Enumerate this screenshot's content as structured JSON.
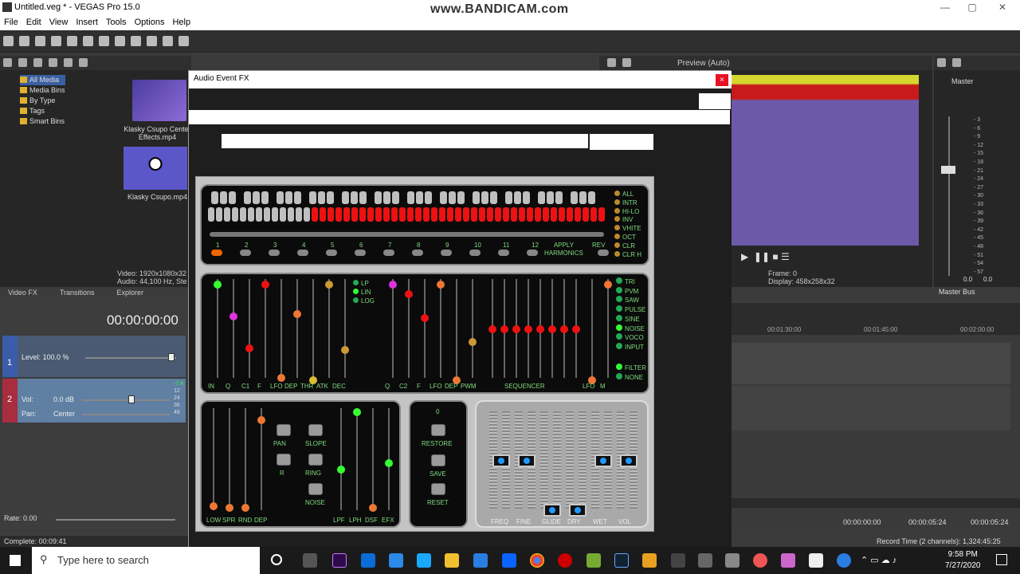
{
  "app": {
    "title": "Untitled.veg * - VEGAS Pro 15.0",
    "watermark": "www.BANDICAM.com"
  },
  "menu": [
    "File",
    "Edit",
    "View",
    "Insert",
    "Tools",
    "Options",
    "Help"
  ],
  "explorer": {
    "tree": [
      "All Media",
      "Media Bins",
      "By Type",
      "Tags",
      "Smart Bins"
    ],
    "media": [
      {
        "name": "Klasky Csupo Center Effects.mp4"
      },
      {
        "name": "Klasky Csupo.mp4"
      }
    ],
    "info": [
      "Video: 1920x1080x32",
      "Audio: 44,100 Hz, Ste"
    ],
    "tabs": [
      "Video FX",
      "Transitions",
      "Explorer"
    ]
  },
  "timecode": "00:00:00:00",
  "tracks": [
    {
      "num": "1",
      "level_label": "Level: 100.0 %"
    },
    {
      "num": "2",
      "vol_label": "Vol:",
      "vol_value": "0.0 dB",
      "pan_label": "Pan:",
      "pan_value": "Center",
      "meter": [
        "-7.4",
        "12",
        "24",
        "36",
        "48"
      ]
    }
  ],
  "rate": "Rate: 0.00",
  "status": "Complete: 00:09:41",
  "dialog": {
    "title": "Audio Event FX",
    "close": "×",
    "keyboard_numbers": [
      "1",
      "2",
      "3",
      "4",
      "5",
      "6",
      "7",
      "8",
      "9",
      "10",
      "11",
      "12"
    ],
    "apply_label": "APPLY\nHARMONICS",
    "rev_label": "REV",
    "wave_opts": [
      "ALL",
      "INTR",
      "HI-LO",
      "INV",
      "VHITE",
      "OCT",
      "CLR",
      "CLR H"
    ],
    "filter_modes": [
      "LP",
      "LIN",
      "LOG"
    ],
    "section2_labels": [
      "IN",
      "Q",
      "C1",
      "F",
      "LFO",
      "DEP",
      "THR",
      "ATK",
      "DEC",
      "Q",
      "C2",
      "F",
      "LFO",
      "DEP",
      "PWM",
      "SEQUENCER",
      "LFO",
      "M"
    ],
    "osc_opts": [
      "TRI",
      "PVM",
      "SAW",
      "PULSE",
      "SINE",
      "NOISE",
      "VOCO",
      "INPUT"
    ],
    "filter_opts": [
      "FILTER",
      "NONE"
    ],
    "section3_labels": [
      "LOW",
      "SPR",
      "RND",
      "DEP",
      "LPF",
      "LPH",
      "DSF",
      "EFX"
    ],
    "buttons": [
      "PAN",
      "SLOPE",
      "R",
      "RING",
      "NOISE"
    ],
    "preset_number": "0",
    "preset_buttons": [
      "RESTORE",
      "SAVE",
      "RESET"
    ],
    "fader_labels": [
      "FREQ",
      "FINE",
      "GLIDE",
      "DRY",
      "WET",
      "VOL"
    ]
  },
  "preview": {
    "label": "Preview (Auto)",
    "frame_label": "Frame:",
    "frame": "0",
    "display_label": "Display:",
    "display": "458x258x32"
  },
  "master": {
    "label": "Master",
    "bus": "Master Bus",
    "scale": [
      "3",
      "6",
      "9",
      "12",
      "15",
      "18",
      "21",
      "24",
      "27",
      "30",
      "33",
      "36",
      "39",
      "42",
      "45",
      "48",
      "51",
      "54",
      "57"
    ],
    "readout": [
      "0.0",
      "0.0"
    ]
  },
  "ruler": [
    "00:01:30:00",
    "00:01:45:00",
    "00:02:00:00"
  ],
  "bottom_times": [
    "00:00:00:00",
    "00:00:05:24",
    "00:00:05:24"
  ],
  "record_time": "Record Time (2 channels): 1,324:45:25",
  "taskbar": {
    "search": "Type here to search",
    "time": "9:58 PM",
    "date": "7/27/2020"
  },
  "colors": {
    "accent": "#e81123",
    "led_green": "#33ff33",
    "key_red": "#e11"
  }
}
